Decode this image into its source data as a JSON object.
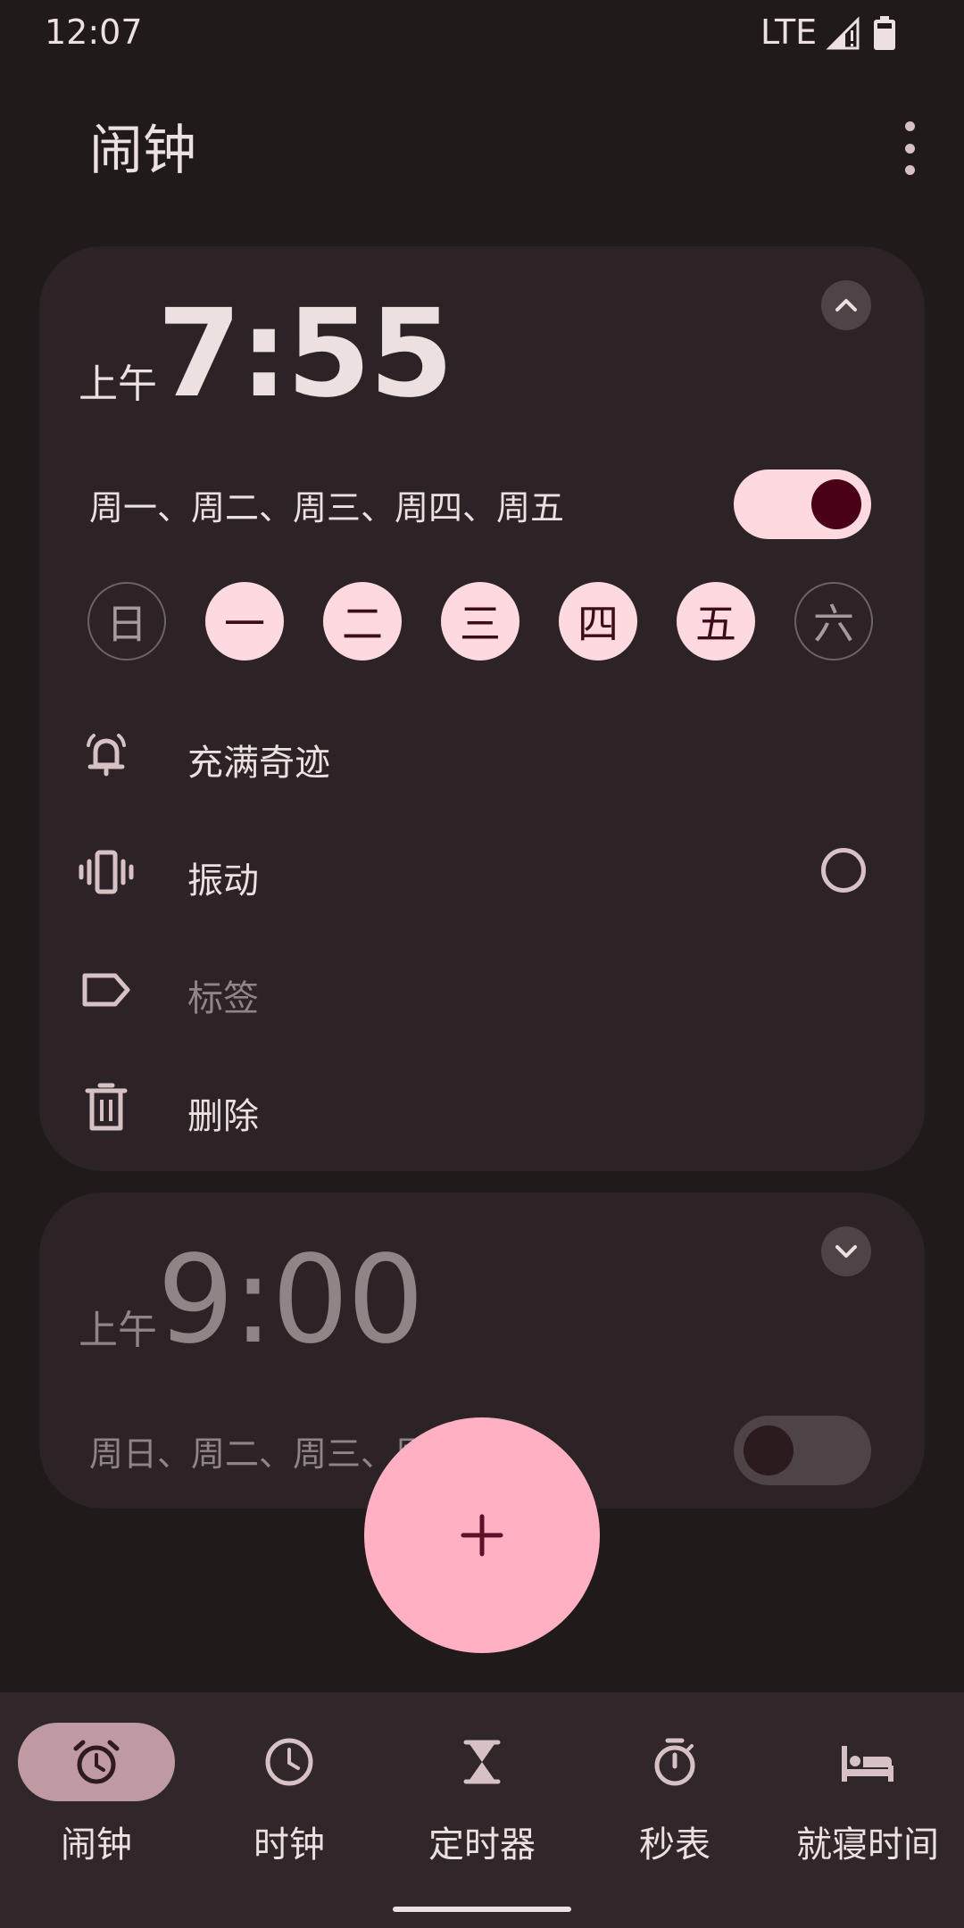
{
  "status_bar": {
    "time": "12:07",
    "network": "LTE"
  },
  "app_bar": {
    "title": "闹钟"
  },
  "alarms": [
    {
      "ampm": "上午",
      "time": "7:55",
      "days_summary": "周一、周二、周三、周四、周五",
      "enabled": true,
      "expanded": true,
      "weekdays": [
        {
          "label": "日",
          "selected": false
        },
        {
          "label": "一",
          "selected": true
        },
        {
          "label": "二",
          "selected": true
        },
        {
          "label": "三",
          "selected": true
        },
        {
          "label": "四",
          "selected": true
        },
        {
          "label": "五",
          "selected": true
        },
        {
          "label": "六",
          "selected": false
        }
      ],
      "options": {
        "ringtone": "充满奇迹",
        "vibrate": "振动",
        "vibrate_checked": false,
        "label_placeholder": "标签",
        "delete": "删除"
      }
    },
    {
      "ampm": "上午",
      "time": "9:00",
      "days_summary": "周日、周二、周三、周",
      "enabled": false,
      "expanded": false
    }
  ],
  "fab": {
    "icon": "plus-icon",
    "label": "+"
  },
  "bottom_nav": {
    "items": [
      {
        "label": "闹钟",
        "icon": "alarm-icon",
        "active": true
      },
      {
        "label": "时钟",
        "icon": "clock-icon",
        "active": false
      },
      {
        "label": "定时器",
        "icon": "hourglass-icon",
        "active": false
      },
      {
        "label": "秒表",
        "icon": "stopwatch-icon",
        "active": false
      },
      {
        "label": "就寝时间",
        "icon": "bed-icon",
        "active": false
      }
    ]
  },
  "colors": {
    "background": "#201a1b",
    "card": "#2b2325",
    "accent": "#ffd9e0",
    "fab": "#ffb1c3",
    "nav_active": "#bf9aa2"
  }
}
